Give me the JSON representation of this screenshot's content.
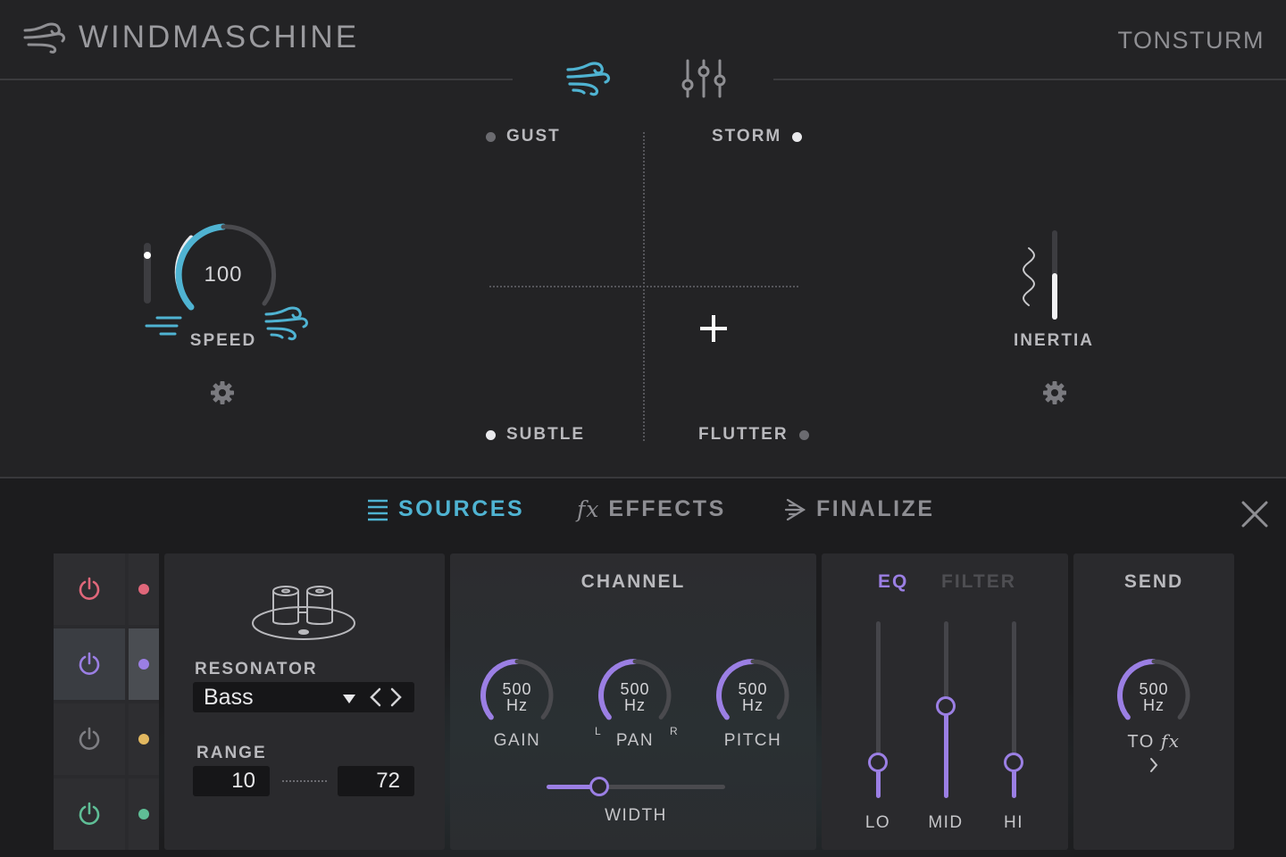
{
  "app": {
    "title": "WINDMASCHINE",
    "brand": "TONSTURM"
  },
  "xy_pad": {
    "corners": {
      "top_left": "GUST",
      "top_right": "STORM",
      "bottom_left": "SUBTLE",
      "bottom_right": "FLUTTER"
    }
  },
  "speed": {
    "value": "100",
    "label": "SPEED",
    "level": 1.0
  },
  "inertia": {
    "label": "INERTIA",
    "level": 0.52
  },
  "tabs": {
    "sources": "SOURCES",
    "effects": "EFFECTS",
    "finalize": "FINALIZE",
    "effects_prefix": "fx"
  },
  "slots": [
    {
      "power_color": "#e0677a",
      "dot_color": "#e0677a"
    },
    {
      "power_color": "#9b7fe4",
      "dot_color": "#9b7fe4"
    },
    {
      "power_color": "#7e7e83",
      "dot_color": "#e2b860"
    },
    {
      "power_color": "#5fbe96",
      "dot_color": "#5fbe96"
    }
  ],
  "resonator": {
    "label": "RESONATOR",
    "selected": "Bass",
    "range_label": "RANGE",
    "range_min": "10",
    "range_max": "72"
  },
  "channel": {
    "title": "CHANNEL",
    "knobs": [
      {
        "value": "500",
        "unit": "Hz",
        "label": "GAIN"
      },
      {
        "value": "500",
        "unit": "Hz",
        "label": "PAN"
      },
      {
        "value": "500",
        "unit": "Hz",
        "label": "PITCH"
      }
    ],
    "pan_left": "L",
    "pan_right": "R",
    "width_label": "WIDTH",
    "width_level": 0.3
  },
  "eq": {
    "tab_eq": "EQ",
    "tab_filter": "FILTER",
    "bands": [
      {
        "label": "LO",
        "level": 0.2
      },
      {
        "label": "MID",
        "level": 0.52
      },
      {
        "label": "HI",
        "level": 0.2
      }
    ]
  },
  "send": {
    "title": "SEND",
    "value": "500",
    "unit": "Hz",
    "to_label": "TO",
    "to_target": "fx"
  },
  "colors": {
    "accent_blue": "#4fb3d2",
    "accent_purple": "#9b7fe4"
  }
}
